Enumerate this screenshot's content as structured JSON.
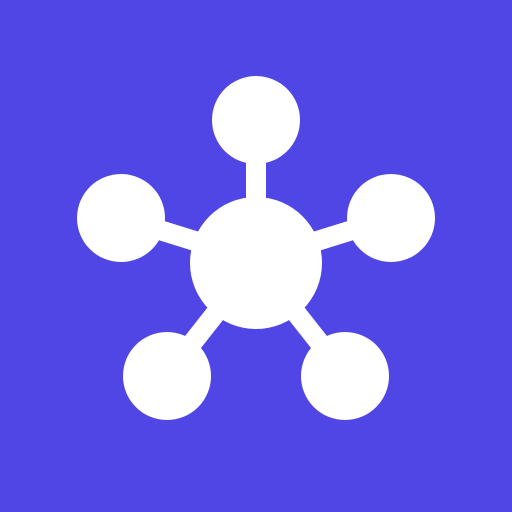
{
  "app": {
    "icon_name": "network-hub-icon"
  },
  "colors": {
    "background": "#4f46e5",
    "foreground": "#ffffff"
  }
}
